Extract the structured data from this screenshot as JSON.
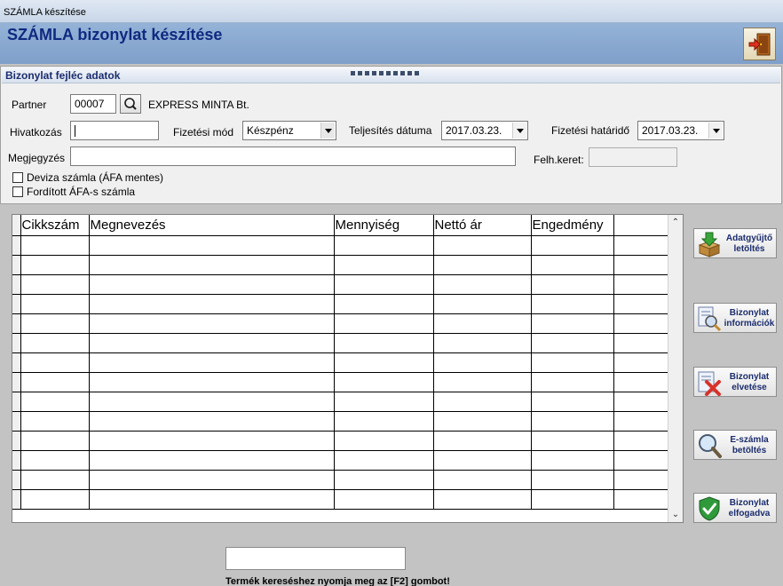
{
  "window": {
    "title": "SZÁMLA készítése"
  },
  "header": {
    "title": "SZÁMLA bizonylat készítése",
    "exit_icon": "exit-door-icon"
  },
  "panel": {
    "title": "Bizonylat fejléc adatok"
  },
  "form": {
    "partner_label": "Partner",
    "partner_code": "00007",
    "partner_name": "EXPRESS MINTA Bt.",
    "reference_label": "Hivatkozás",
    "reference_value": "",
    "payment_label": "Fizetési mód",
    "payment_value": "Készpénz",
    "fulfillment_label": "Teljesítés dátuma",
    "fulfillment_value": "2017.03.23.",
    "due_label": "Fizetési határidő",
    "due_value": "2017.03.23.",
    "note_label": "Megjegyzés",
    "note_value": "",
    "credit_label": "Felh.keret:",
    "credit_value": "",
    "foreign_currency_label": "Deviza számla (ÁFA mentes)",
    "reverse_vat_label": "Fordított ÁFA-s számla"
  },
  "grid": {
    "columns": [
      "Cikkszám",
      "Megnevezés",
      "Mennyiség",
      "Nettó ár",
      "Engedmény"
    ],
    "empty_rows": 14
  },
  "actions": [
    {
      "label": "Adatgyűjtő letöltés",
      "icon": "download-box-icon"
    },
    {
      "label": "Bizonylat információk",
      "icon": "document-search-icon"
    },
    {
      "label": "Bizonylat elvetése",
      "icon": "document-delete-icon"
    },
    {
      "label": "E-számla betöltés",
      "icon": "magnifier-icon"
    },
    {
      "label": "Bizonylat elfogadva",
      "icon": "shield-check-icon"
    }
  ],
  "footer": {
    "search_value": "",
    "hint": "Termék kereséshez nyomja meg az [F2] gombot!"
  },
  "colors": {
    "title_blue": "#0f2a80",
    "banner": "#8aa9d1"
  }
}
